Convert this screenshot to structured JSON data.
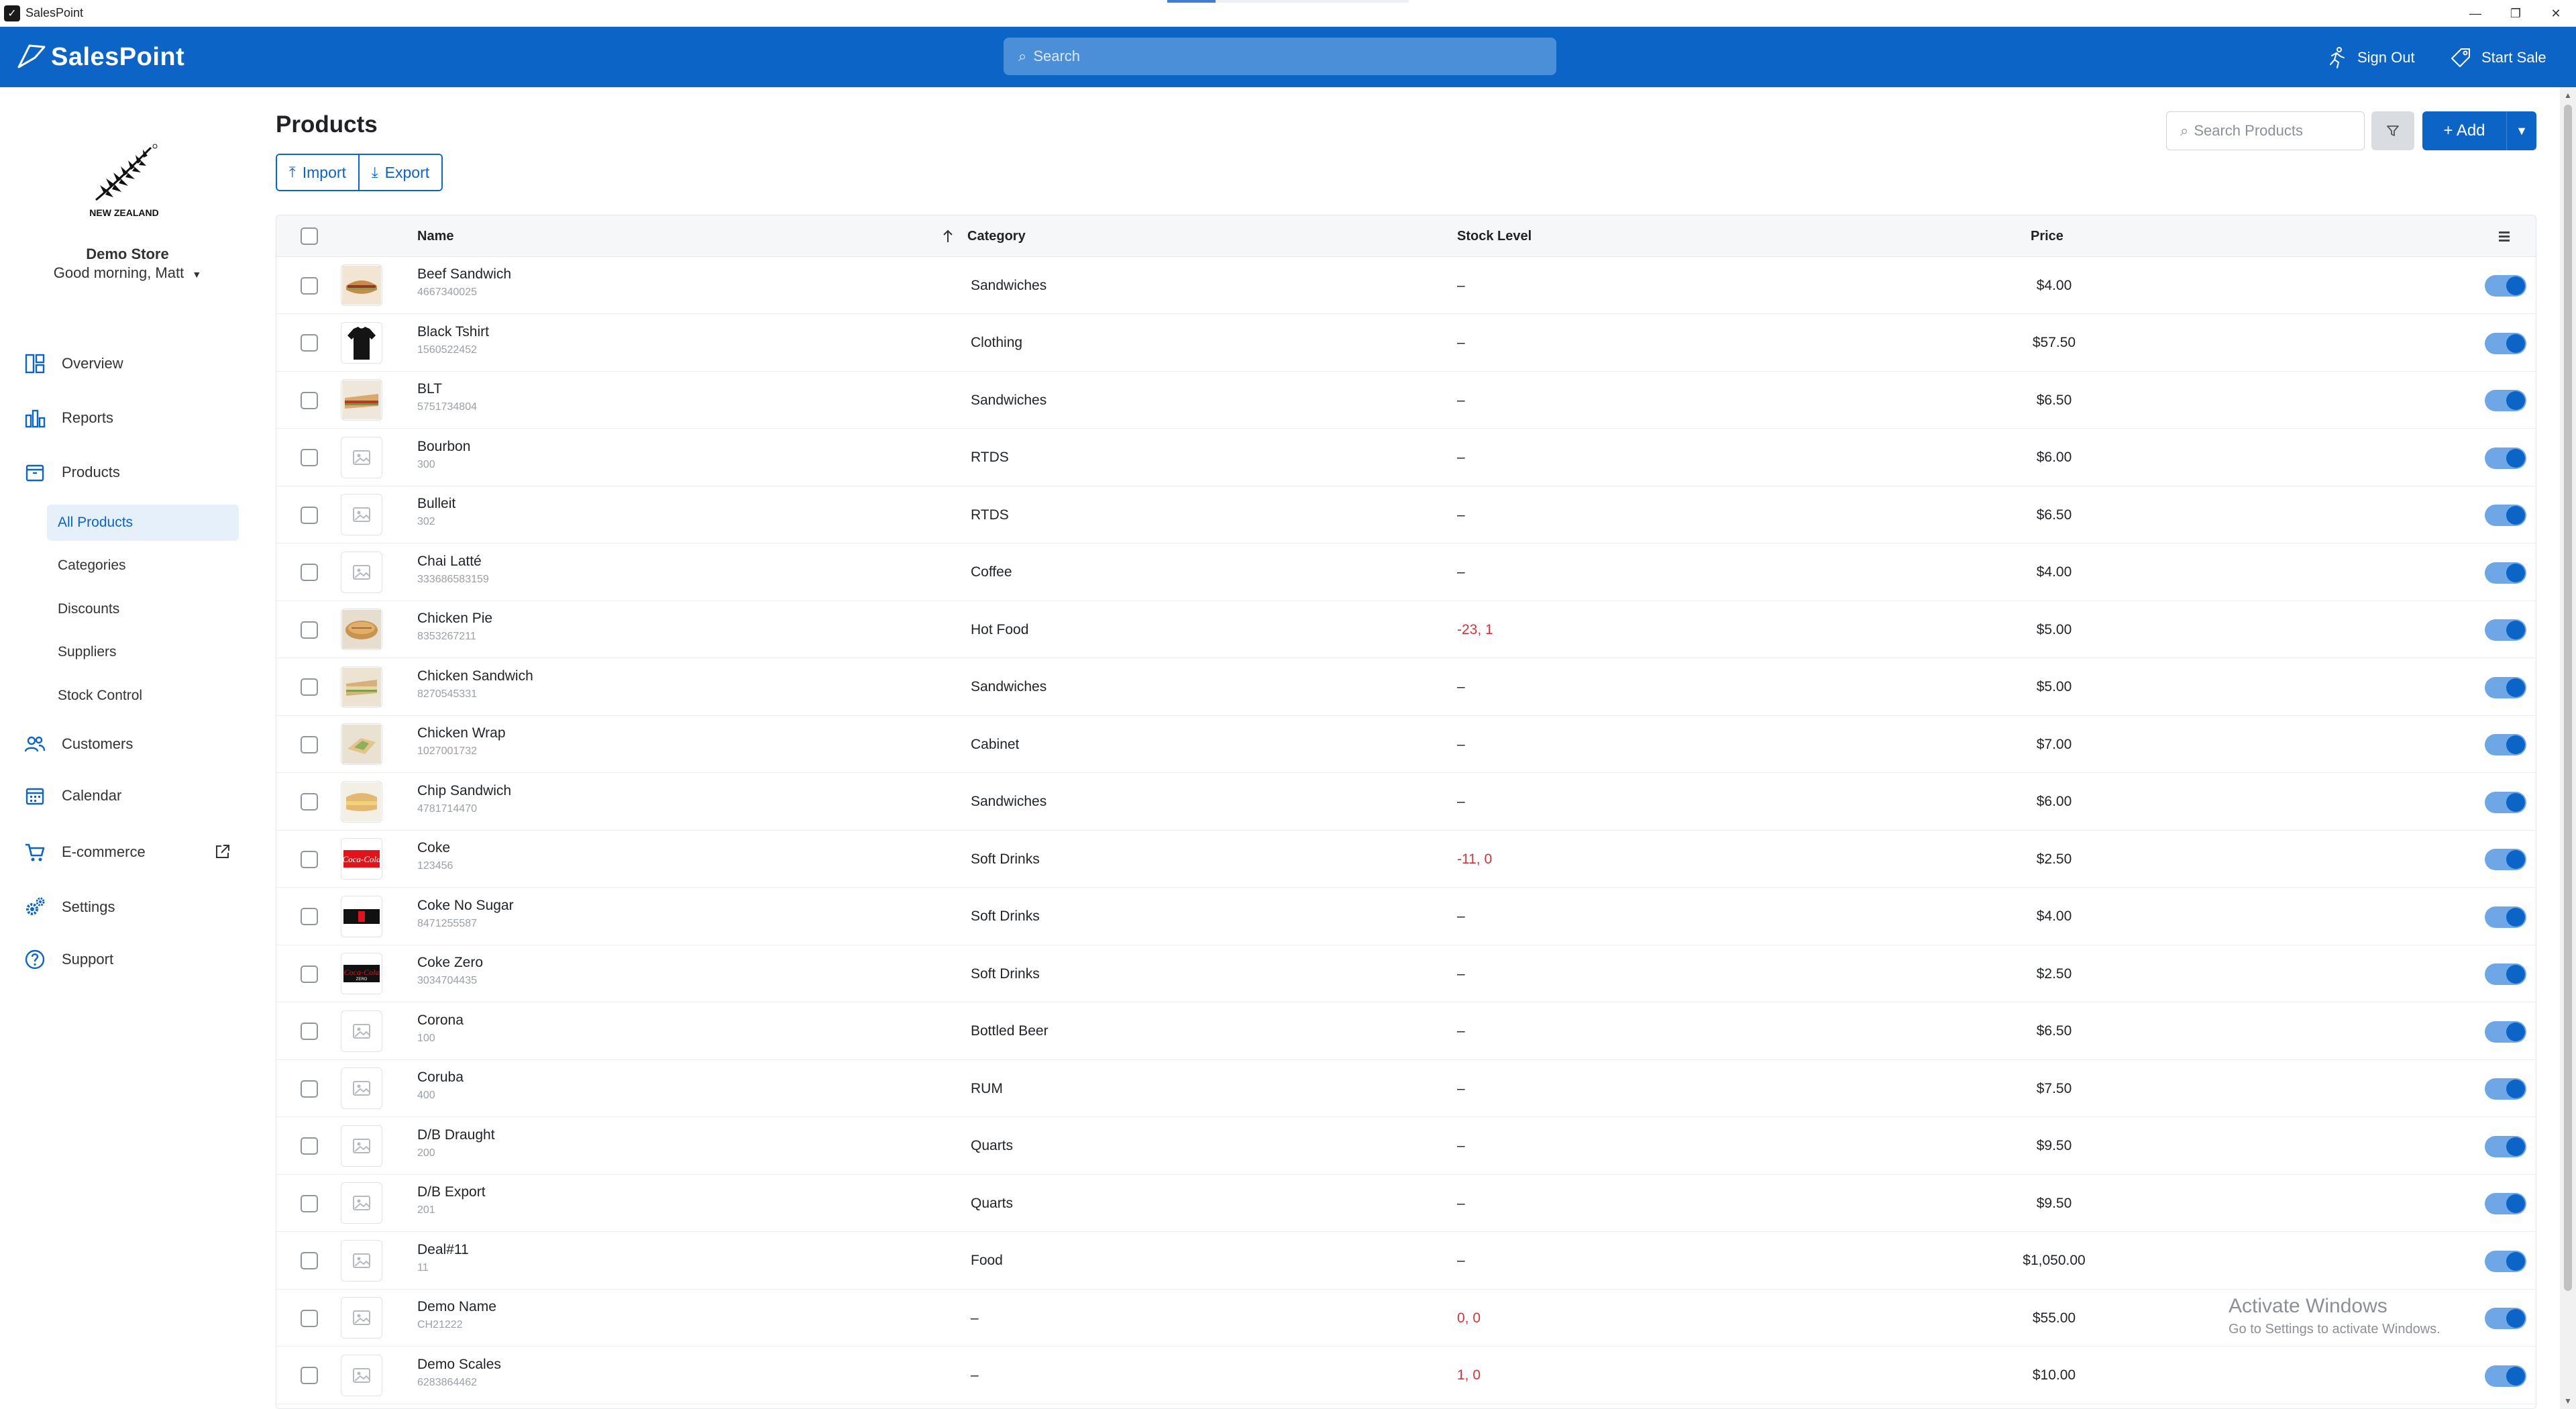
{
  "window": {
    "title": "SalesPoint"
  },
  "header": {
    "brand": "SalesPoint",
    "search_placeholder": "Search",
    "sign_out": "Sign Out",
    "start_sale": "Start Sale"
  },
  "sidebar": {
    "logo_text": "NEW ZEALAND",
    "store_name": "Demo Store",
    "greeting": "Good morning, Matt",
    "nav": {
      "overview": "Overview",
      "reports": "Reports",
      "products": "Products",
      "customers": "Customers",
      "calendar": "Calendar",
      "ecommerce": "E-commerce",
      "settings": "Settings",
      "support": "Support"
    },
    "products_sub": {
      "all_products": "All Products",
      "categories": "Categories",
      "discounts": "Discounts",
      "suppliers": "Suppliers",
      "stock_control": "Stock Control"
    }
  },
  "main": {
    "title": "Products",
    "import": "Import",
    "export": "Export",
    "search_placeholder": "Search Products",
    "add": "+ Add"
  },
  "table": {
    "columns": {
      "name": "Name",
      "category": "Category",
      "stock": "Stock Level",
      "price": "Price"
    },
    "rows": [
      {
        "name": "Beef Sandwich",
        "sku": "4667340025",
        "category": "Sandwiches",
        "stock": "–",
        "price": "$4.00"
      },
      {
        "name": "Black Tshirt",
        "sku": "1560522452",
        "category": "Clothing",
        "stock": "–",
        "price": "$57.50"
      },
      {
        "name": "BLT",
        "sku": "5751734804",
        "category": "Sandwiches",
        "stock": "–",
        "price": "$6.50"
      },
      {
        "name": "Bourbon",
        "sku": "300",
        "category": "RTDS",
        "stock": "–",
        "price": "$6.00"
      },
      {
        "name": "Bulleit",
        "sku": "302",
        "category": "RTDS",
        "stock": "–",
        "price": "$6.50"
      },
      {
        "name": "Chai Latté",
        "sku": "333686583159",
        "category": "Coffee",
        "stock": "–",
        "price": "$4.00"
      },
      {
        "name": "Chicken Pie",
        "sku": "8353267211",
        "category": "Hot Food",
        "stock": "-23, 1",
        "price": "$5.00"
      },
      {
        "name": "Chicken Sandwich",
        "sku": "8270545331",
        "category": "Sandwiches",
        "stock": "–",
        "price": "$5.00"
      },
      {
        "name": "Chicken Wrap",
        "sku": "1027001732",
        "category": "Cabinet",
        "stock": "–",
        "price": "$7.00"
      },
      {
        "name": "Chip Sandwich",
        "sku": "4781714470",
        "category": "Sandwiches",
        "stock": "–",
        "price": "$6.00"
      },
      {
        "name": "Coke",
        "sku": "123456",
        "category": "Soft Drinks",
        "stock": "-11, 0",
        "price": "$2.50"
      },
      {
        "name": "Coke No Sugar",
        "sku": "8471255587",
        "category": "Soft Drinks",
        "stock": "–",
        "price": "$4.00"
      },
      {
        "name": "Coke Zero",
        "sku": "3034704435",
        "category": "Soft Drinks",
        "stock": "–",
        "price": "$2.50"
      },
      {
        "name": "Corona",
        "sku": "100",
        "category": "Bottled Beer",
        "stock": "–",
        "price": "$6.50"
      },
      {
        "name": "Coruba",
        "sku": "400",
        "category": "RUM",
        "stock": "–",
        "price": "$7.50"
      },
      {
        "name": "D/B Draught",
        "sku": "200",
        "category": "Quarts",
        "stock": "–",
        "price": "$9.50"
      },
      {
        "name": "D/B Export",
        "sku": "201",
        "category": "Quarts",
        "stock": "–",
        "price": "$9.50"
      },
      {
        "name": "Deal#11",
        "sku": "11",
        "category": "Food",
        "stock": "–",
        "price": "$1,050.00"
      },
      {
        "name": "Demo Name",
        "sku": "CH21222",
        "category": "–",
        "stock": "0, 0",
        "price": "$55.00"
      },
      {
        "name": "Demo Scales",
        "sku": "6283864462",
        "category": "–",
        "stock": "1, 0",
        "price": "$10.00"
      }
    ]
  },
  "watermark": {
    "line1": "Activate Windows",
    "line2": "Go to Settings to activate Windows."
  }
}
